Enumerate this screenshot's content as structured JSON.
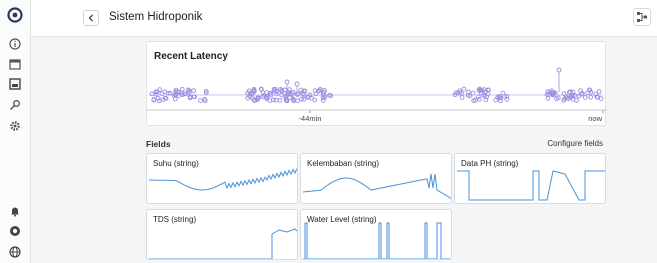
{
  "header": {
    "title": "Sistem Hidroponik"
  },
  "latency": {
    "title": "Recent Latency",
    "axis_labels": [
      "-44min",
      "now"
    ]
  },
  "fields": {
    "label": "Fields",
    "configure_label": "Configure fields",
    "cards": [
      {
        "title": "Suhu (string)"
      },
      {
        "title": "Kelembaban (string)"
      },
      {
        "title": "Data PH (string)"
      },
      {
        "title": "TDS (string)"
      },
      {
        "title": "Water Level (string)"
      }
    ]
  },
  "sidebar": {
    "top_icons": [
      "logo-icon",
      "info-icon",
      "calendar-icon",
      "panel-icon",
      "key-icon",
      "gear-icon"
    ],
    "bottom_icons": [
      "bell-icon",
      "help-icon",
      "globe-icon"
    ]
  },
  "colors": {
    "accent": "#4a90d9",
    "latency_points": "#9a8fe0"
  }
}
